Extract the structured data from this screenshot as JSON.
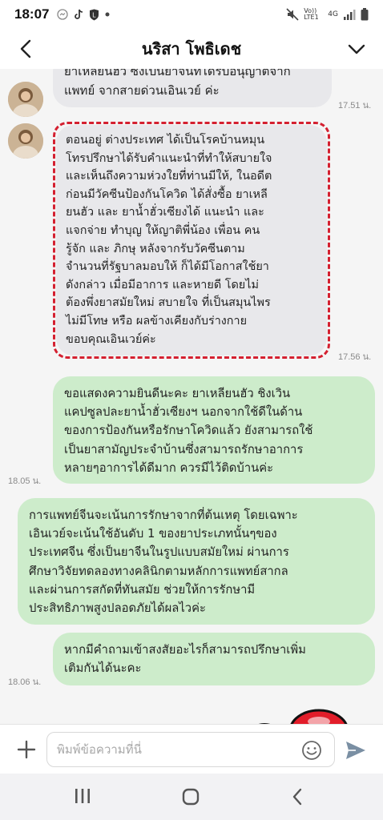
{
  "status_bar": {
    "time": "18:07",
    "network_label": "Vo)) LTE1",
    "network_type": "4G"
  },
  "header": {
    "title": "นริสา โพธิเดช"
  },
  "messages": [
    {
      "id": "m1",
      "direction": "incoming",
      "lines": [
        "ยาเหลียนฮัว ซึ่งเป็นยาจีนที่ได้รับอนุญาตจาก",
        "แพทย์ จากสายด่วนเอินเวย์ ค่ะ"
      ],
      "time": "17.51 น."
    },
    {
      "id": "m2",
      "direction": "incoming",
      "highlighted": true,
      "lines": [
        "ตอนอยู่ ต่างประเทศ ได้เป็นโรคบ้านหมุน",
        "โทรปรึกษาได้รับคำแนะนำที่ทำให้สบายใจ",
        "และเห็นถึงความห่วงใยที่ท่านมีให้, ในอดีต",
        "ก่อนมีวัคซีนป้องกันโควิด ได้สั่งซื้อ ยาเหลี",
        "ยนฮัว และ ยาน้ำฮั่วเซียงได้ แนะนำ และ",
        "แจกจ่าย ทำบุญ ให้ญาติพี่น้อง เพื่อน คน",
        "รู้จัก และ ภิกษุ หลังจากรับวัคซีนตาม",
        "จำนวนที่รัฐบาลมอบให้ ก็ได้มีโอกาสใช้ยา",
        "ดังกล่าว เมื่อมีอาการ และหายดี โดยไม่",
        "ต้องพึ่งยาสมัยใหม่ สบายใจ ที่เป็นสมุนไพร",
        "ไม่มีโทษ หรือ ผลข้างเคียงกับร่างกาย",
        "ขอบคุณเอินเวย์ค่ะ"
      ],
      "time": "17.56 น."
    },
    {
      "id": "m3",
      "direction": "outgoing",
      "lines": [
        "ขอแสดงความยินดีนะคะ ยาเหลียนฮัว ชิงเวิน",
        "แคปซูลปละยาน้ำฮั่วเซียงฯ นอกจากใช้ดีในด้าน",
        "ของการป้องกันหรือรักษาโควิดแล้ว ยังสามารถใช้",
        "เป็นยาสามัญประจำบ้านซึ่งสามารถรักษาอาการ",
        "หลายๆอาการได้ดีมาก ควรมีไว้ติดบ้านค่ะ"
      ],
      "time": "18.05 น."
    },
    {
      "id": "m4",
      "direction": "outgoing",
      "lines": [
        "การแพทย์จีนจะเน้นการรักษาจากที่ต้นเหตุ โดยเฉพาะ",
        "เอินเวย์จะเน้นใช้อันดับ 1 ของยาประเภทนั้นๆของ",
        "ประเทศจีน ซึ่งเป็นยาจีนในรูปแบบสมัยใหม่ ผ่านการ",
        "ศึกษาวิจัยทดลองทางคลินิกตามหลักการแพทย์สากล",
        "และผ่านการสกัดที่ทันสมัย ช่วยให้การรักษามี",
        "ประสิทธิภาพสูงปลอดภัยได้ผลไวค่ะ"
      ]
    },
    {
      "id": "m5",
      "direction": "outgoing",
      "lines": [
        "หากมีคำถามเข้าสงสัยอะไรก็สามารถปรึกษาเพิ่ม",
        "เติมกันได้นะคะ"
      ],
      "time": "18.06 น."
    }
  ],
  "input": {
    "placeholder": "พิมพ์ข้อความที่นี่",
    "value": ""
  },
  "icons": {
    "back": "back-arrow-icon",
    "menu": "chevron-down-icon",
    "plus": "plus-icon",
    "emoji": "emoji-smile-icon",
    "send": "send-icon",
    "nav_recents": "recents-icon",
    "nav_home": "home-icon",
    "nav_back": "nav-back-icon"
  },
  "colors": {
    "incoming_bubble": "#e8e8eb",
    "outgoing_bubble": "#cdeccb",
    "highlight_border": "#d42030",
    "send_icon": "#7a8fa3"
  }
}
